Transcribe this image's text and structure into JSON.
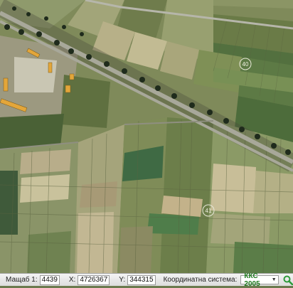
{
  "map": {
    "markers": [
      "40",
      "41"
    ]
  },
  "statusbar": {
    "scale_label": "Мащаб 1:",
    "scale_value": "4439",
    "x_label": "X:",
    "x_value": "4726367",
    "y_label": "Y:",
    "y_value": "344315",
    "coord_system_label": "Координатна система:",
    "coord_system_value": "ККС 2005",
    "search_icon": "search-icon"
  },
  "colors": {
    "coord_system": "#1e7a1e",
    "search_icon": "#2e9a3a"
  }
}
